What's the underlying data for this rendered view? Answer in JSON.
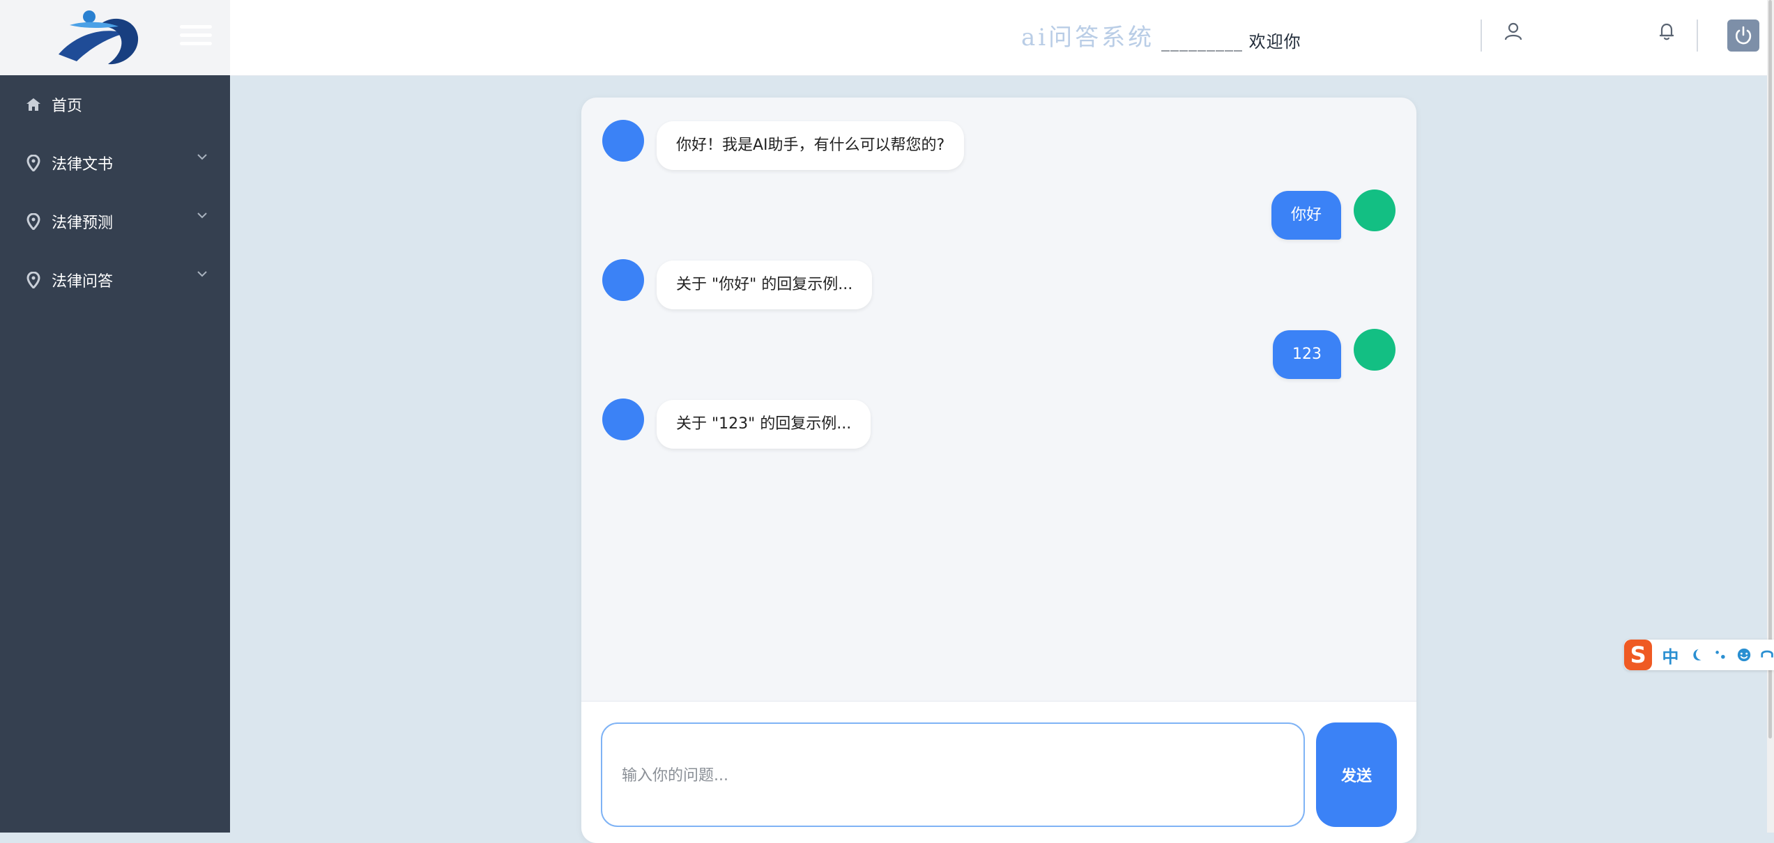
{
  "header": {
    "brand": "ai问答系统",
    "welcome": "_________ 欢迎你"
  },
  "sidebar": {
    "items": [
      {
        "label": "首页",
        "icon": "home-icon",
        "expandable": false
      },
      {
        "label": "法律文书",
        "icon": "location-pin-icon",
        "expandable": true
      },
      {
        "label": "法律预测",
        "icon": "location-pin-icon",
        "expandable": true
      },
      {
        "label": "法律问答",
        "icon": "location-pin-icon",
        "expandable": true
      }
    ]
  },
  "chat": {
    "messages": [
      {
        "role": "bot",
        "text": "你好！我是AI助手，有什么可以帮您的?"
      },
      {
        "role": "user",
        "text": "你好"
      },
      {
        "role": "bot",
        "text": "关于 \"你好\" 的回复示例..."
      },
      {
        "role": "user",
        "text": "123"
      },
      {
        "role": "bot",
        "text": "关于 \"123\" 的回复示例..."
      }
    ],
    "input_placeholder": "输入你的问题...",
    "input_value": "",
    "send_label": "发送"
  },
  "ime": {
    "logo": "S",
    "mode": "中",
    "items": [
      "moon-icon",
      "punctuation-icon",
      "emoji-icon",
      "headset-icon"
    ]
  },
  "colors": {
    "sidebar_bg": "#354050",
    "page_bg": "#dbe6ee",
    "bot_avatar": "#3b82f6",
    "user_avatar": "#13bf83",
    "user_bubble": "#3b82f6",
    "send_button": "#3b82f6",
    "brand_text": "#b9cde6"
  }
}
